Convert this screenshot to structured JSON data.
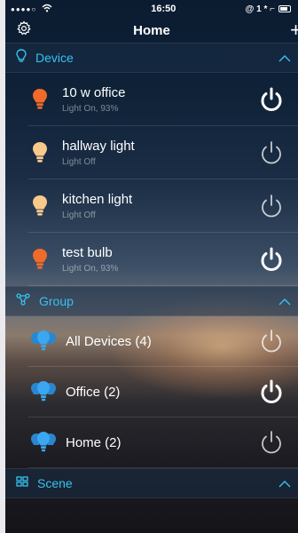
{
  "status_bar": {
    "signal": "●●●●○",
    "time": "16:50",
    "right_icons": "@ 1 * ⌐"
  },
  "nav": {
    "title": "Home",
    "add_label": "+"
  },
  "device_section": {
    "label": "Device"
  },
  "devices": [
    {
      "name": "10 w office",
      "status": "Light On, 93%",
      "on": true
    },
    {
      "name": "hallway light",
      "status": "Light Off",
      "on": false
    },
    {
      "name": "kitchen light",
      "status": "Light Off",
      "on": false
    },
    {
      "name": "test bulb",
      "status": "Light On, 93%",
      "on": true
    }
  ],
  "group_section": {
    "label": "Group"
  },
  "groups": [
    {
      "name": "All Devices (4)",
      "on": false
    },
    {
      "name": "Office (2)",
      "on": true
    },
    {
      "name": "Home (2)",
      "on": false
    }
  ],
  "scene_section": {
    "label": "Scene"
  },
  "colors": {
    "accent": "#35c3f0",
    "bulb_on": "#f06a2a",
    "bulb_off": "#f8c98a",
    "group_bulb": "#3aa7f0"
  }
}
